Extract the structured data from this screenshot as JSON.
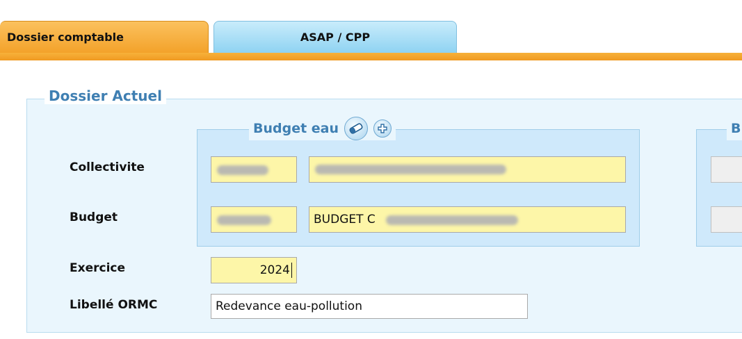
{
  "tabs": [
    {
      "label": "Dossier comptable",
      "active": true
    },
    {
      "label": "ASAP / CPP",
      "active": false
    }
  ],
  "section": {
    "title": "Dossier Actuel"
  },
  "budget_eau": {
    "title": "Budget eau",
    "clear_icon": "eraser-icon",
    "add_icon": "plus-icon"
  },
  "budget_right": {
    "title_partial": "B"
  },
  "form": {
    "collectivite": {
      "label": "Collectivite",
      "code_value": "",
      "name_value": ""
    },
    "budget": {
      "label": "Budget",
      "code_value": "",
      "name_value": "BUDGET C"
    },
    "exercice": {
      "label": "Exercice",
      "value": "2024"
    },
    "libelle": {
      "label": "Libellé ORMC",
      "value": "Redevance eau-pollution"
    }
  },
  "colors": {
    "active_tab": "#f3a22a",
    "inactive_tab": "#8fd3f2",
    "legend_text": "#3f7fb2",
    "field_yellow": "#fdf6a8",
    "panel_bg": "#eaf6fd",
    "subpanel_bg": "#cfe9fb"
  }
}
